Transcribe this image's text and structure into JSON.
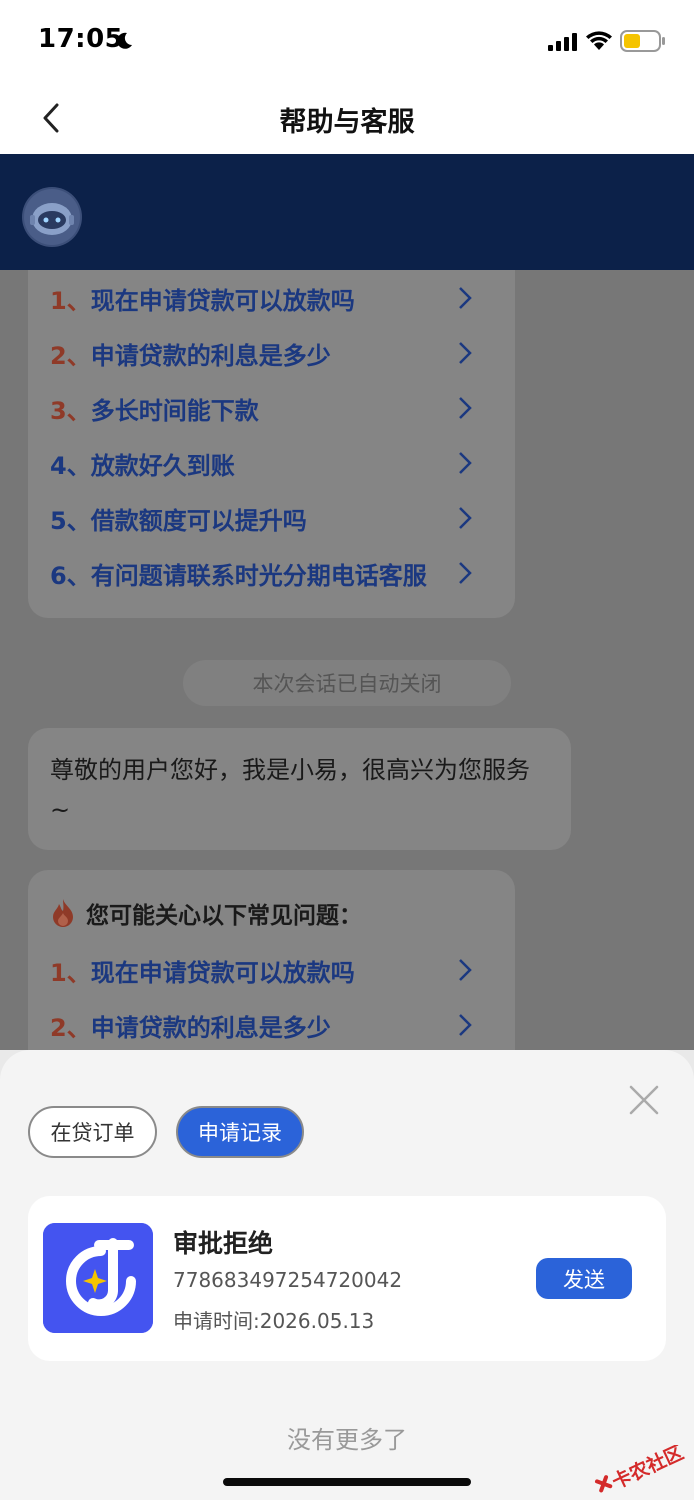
{
  "status_bar": {
    "time": "17:05"
  },
  "nav": {
    "title": "帮助与客服"
  },
  "faq_top": [
    {
      "num": "1、",
      "text": "现在申请贷款可以放款吗"
    },
    {
      "num": "2、",
      "text": "申请贷款的利息是多少"
    },
    {
      "num": "3、",
      "text": "多长时间能下款"
    },
    {
      "num": "4、",
      "text": "放款好久到账"
    },
    {
      "num": "5、",
      "text": "借款额度可以提升吗"
    },
    {
      "num": "6、",
      "text": "有问题请联系时光分期电话客服"
    }
  ],
  "session_closed": "本次会话已自动关闭",
  "greeting": "尊敬的用户您好，我是小易，很高兴为您服务~",
  "faq_bottom": {
    "heading": "您可能关心以下常见问题：",
    "items": [
      {
        "num": "1、",
        "text": "现在申请贷款可以放款吗"
      },
      {
        "num": "2、",
        "text": "申请贷款的利息是多少"
      }
    ]
  },
  "sheet": {
    "tabs": {
      "loan_orders": "在贷订单",
      "applications": "申请记录"
    },
    "record": {
      "status": "审批拒绝",
      "id": "778683497254720042",
      "date": "申请时间:2026.05.13",
      "send": "发送"
    },
    "no_more": "没有更多了"
  },
  "watermark": "卡农社区",
  "colors": {
    "accent": "#2b63d9",
    "header_dark": "#0c2149",
    "faq_link": "#1b3880",
    "faq_number": "#8f3a28"
  }
}
